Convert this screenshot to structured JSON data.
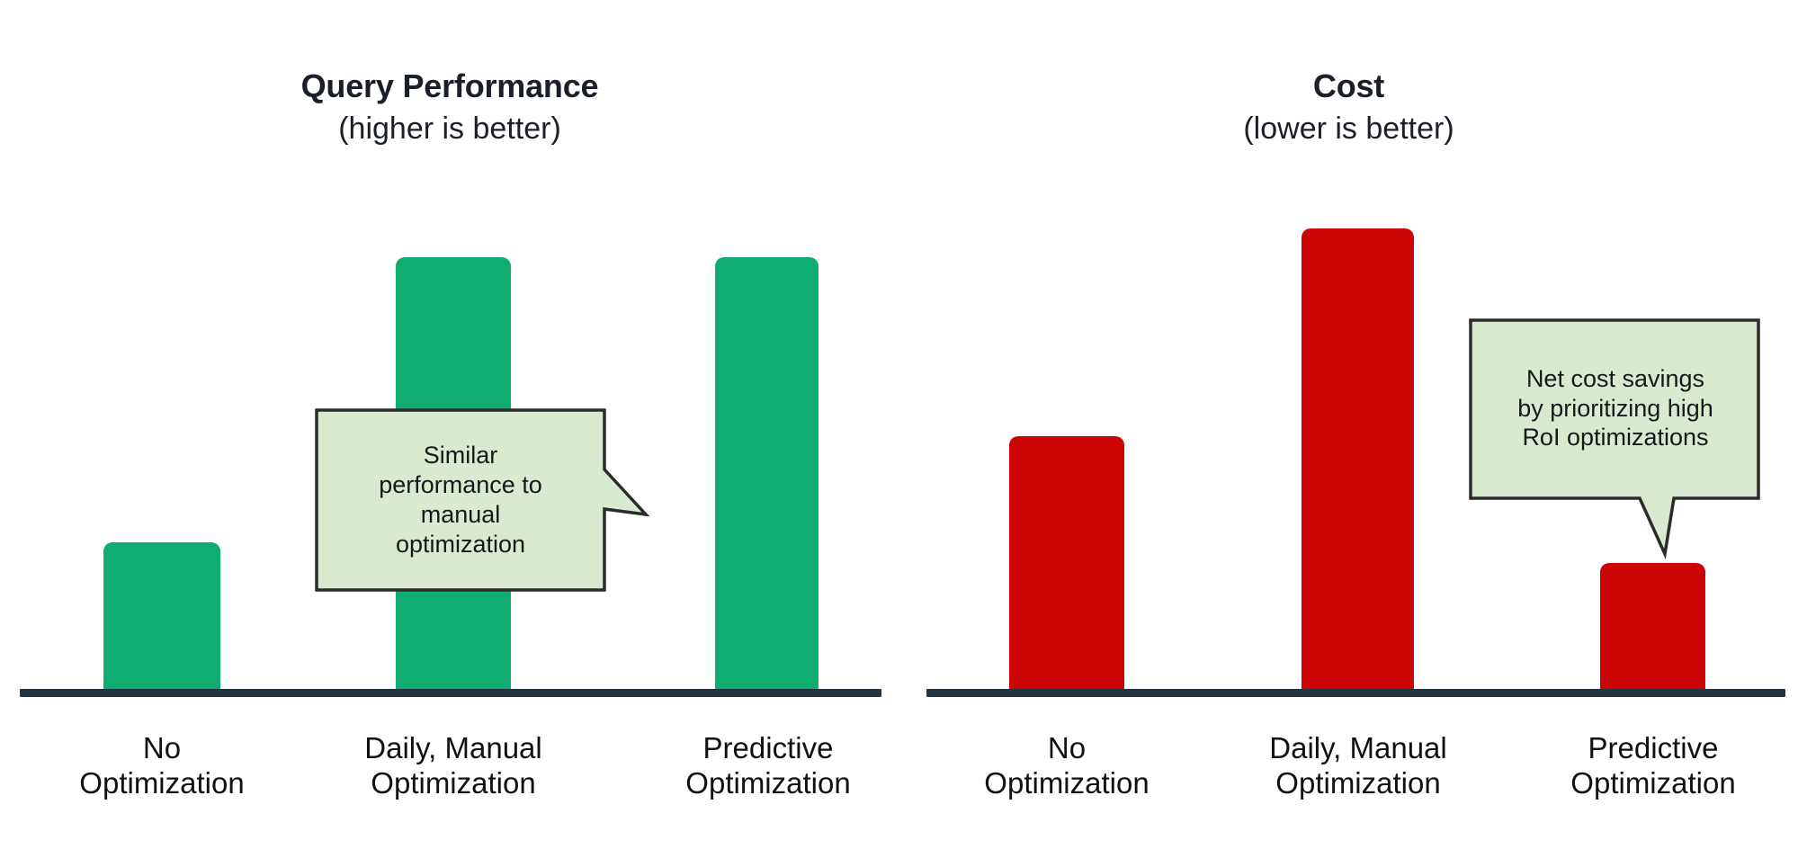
{
  "chart_data": [
    {
      "type": "bar",
      "title": "Query Performance",
      "subtitle": "(higher is better)",
      "xlabel": "",
      "ylabel": "",
      "grid": false,
      "legend": "none",
      "axis_visible": true,
      "bar_color": "#10ad72",
      "ylim": [
        0,
        100
      ],
      "categories": [
        "No Optimization",
        "Daily, Manual Optimization",
        "Predictive Optimization"
      ],
      "category_lines": [
        [
          "No",
          "Optimization"
        ],
        [
          "Daily, Manual",
          "Optimization"
        ],
        [
          "Predictive",
          "Optimization"
        ]
      ],
      "values": [
        27,
        81,
        81
      ],
      "annotations": [
        {
          "text": "Similar\nperformance to\nmanual\noptimization",
          "points_to": "Predictive Optimization",
          "tail_direction": "right"
        }
      ]
    },
    {
      "type": "bar",
      "title": "Cost",
      "subtitle": "(lower is better)",
      "xlabel": "",
      "ylabel": "",
      "grid": false,
      "legend": "none",
      "axis_visible": true,
      "bar_color": "#cc0606",
      "ylim": [
        0,
        100
      ],
      "categories": [
        "No Optimization",
        "Daily, Manual Optimization",
        "Predictive Optimization"
      ],
      "category_lines": [
        [
          "No",
          "Optimization"
        ],
        [
          "Daily, Manual",
          "Optimization"
        ],
        [
          "Predictive",
          "Optimization"
        ]
      ],
      "values": [
        49,
        88,
        24
      ],
      "annotations": [
        {
          "text": "Net cost savings\nby prioritizing high\nRoI optimizations",
          "points_to": "Predictive Optimization",
          "tail_direction": "down-left"
        }
      ]
    }
  ],
  "colors": {
    "green": "#10ad72",
    "red": "#cc0606",
    "axis": "#24333d",
    "callout_fill": "#d9ead1",
    "callout_stroke": "#2b2b2b",
    "title_text": "#1b1f2a",
    "background": "#ffffff"
  }
}
